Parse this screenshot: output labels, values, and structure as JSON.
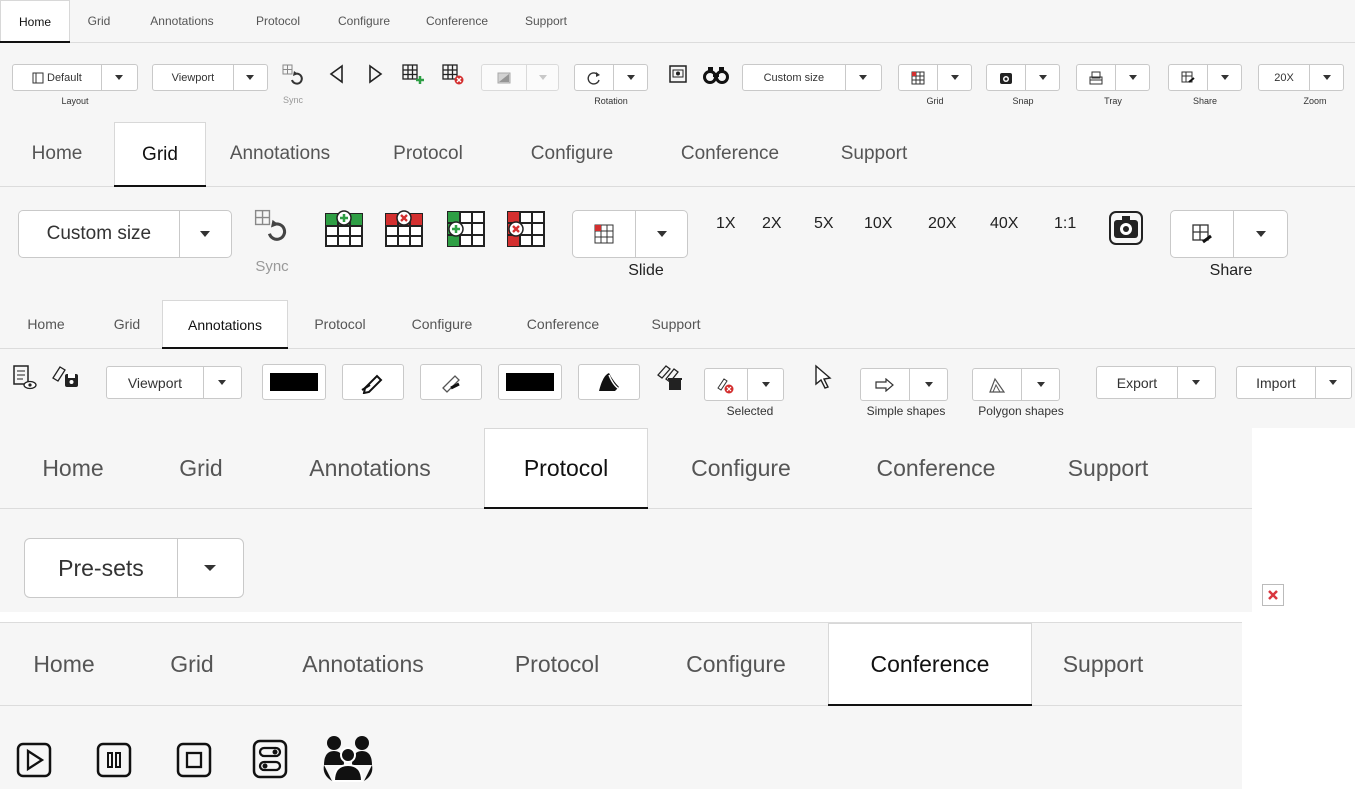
{
  "tabs": [
    "Home",
    "Grid",
    "Annotations",
    "Protocol",
    "Configure",
    "Conference",
    "Support"
  ],
  "home": {
    "active_tab": "Home",
    "layout_button": "Default",
    "layout_caption": "Layout",
    "viewport_button": "Viewport",
    "sync_caption": "Sync",
    "rotation_caption": "Rotation",
    "custom_size_button": "Custom size",
    "grid_caption": "Grid",
    "snap_caption": "Snap",
    "tray_caption": "Tray",
    "share_caption": "Share",
    "zoom_value": "20X",
    "zoom_caption": "Zoom"
  },
  "grid": {
    "active_tab": "Grid",
    "custom_size_button": "Custom size",
    "sync_caption": "Sync",
    "slide_caption": "Slide",
    "zoom_levels": [
      "1X",
      "2X",
      "5X",
      "10X",
      "20X",
      "40X",
      "1:1"
    ],
    "share_caption": "Share"
  },
  "annotations": {
    "active_tab": "Annotations",
    "viewport_button": "Viewport",
    "selected_caption": "Selected",
    "simple_shapes_caption": "Simple shapes",
    "polygon_shapes_caption": "Polygon shapes",
    "export_button": "Export",
    "import_button": "Import"
  },
  "protocol": {
    "active_tab": "Protocol",
    "presets_button": "Pre-sets"
  },
  "conference": {
    "active_tab": "Conference"
  },
  "colors": {
    "toolbar_bg": "#f6f6f6",
    "active_underline": "#111111",
    "grid_green": "#2e9e44",
    "grid_red": "#d32f2f",
    "broken_image_red": "#d9363e"
  }
}
